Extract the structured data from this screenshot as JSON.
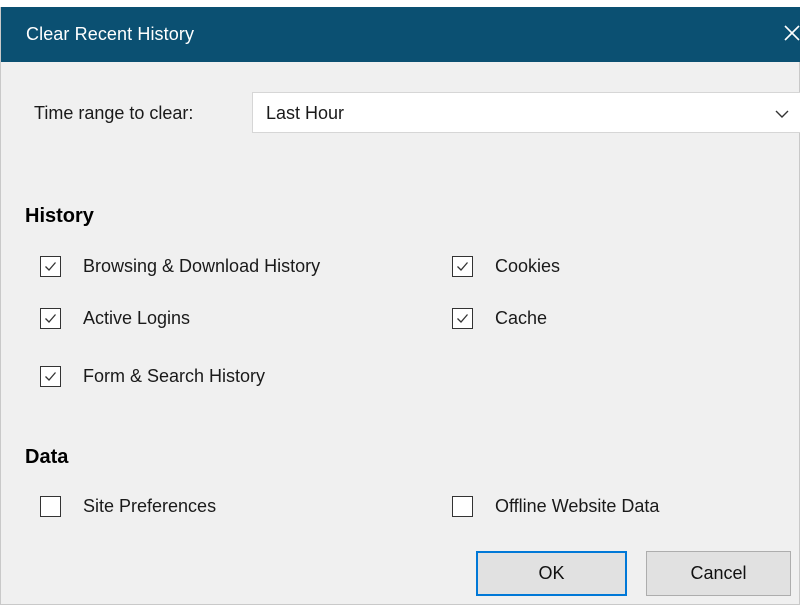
{
  "dialog": {
    "title": "Clear Recent History",
    "close_icon": "close-icon"
  },
  "time_range": {
    "label": "Time range to clear:",
    "selected": "Last Hour",
    "icon": "chevron-down-icon"
  },
  "history": {
    "heading": "History",
    "items": [
      {
        "label": "Browsing & Download History",
        "checked": true
      },
      {
        "label": "Cookies",
        "checked": true
      },
      {
        "label": "Active Logins",
        "checked": true
      },
      {
        "label": "Cache",
        "checked": true
      },
      {
        "label": "Form & Search History",
        "checked": true
      }
    ]
  },
  "data_section": {
    "heading": "Data",
    "items": [
      {
        "label": "Site Preferences",
        "checked": false
      },
      {
        "label": "Offline Website Data",
        "checked": false
      }
    ]
  },
  "buttons": {
    "ok": "OK",
    "cancel": "Cancel"
  },
  "colors": {
    "titlebar": "#0b5072",
    "dialog_bg": "#f0f0f0",
    "focus_border": "#0078d7"
  }
}
